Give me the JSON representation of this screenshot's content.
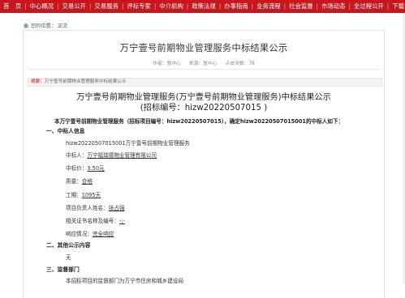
{
  "nav": {
    "items": [
      "首　页",
      "中心概况",
      "交易公开",
      "交易服务",
      "评标专家",
      "中介机构",
      "政策法规",
      "办事指南",
      "业务流程",
      "社会监督",
      "市场动态",
      "全过程公开",
      "下载专区"
    ]
  },
  "breadcrumb": {
    "prefix": "您的位置：",
    "current": "正文"
  },
  "article": {
    "title": "万宁壹号前期物业管理服务中标结果公示",
    "meta": {
      "author": "作者：暂中心",
      "source": "来源：暂中心",
      "views": "点击次数：76"
    },
    "summary_label": "摘要：",
    "summary_text": "万宁壹号前期物业管理服务中标结果公示",
    "doc_title_line1": "万宁壹号前期物业管理服务(万宁壹号前期物业管理服务)中标结果公示",
    "doc_title_line2": "(招标编号：hizw20220507015 )",
    "notice": "本万宁壹号前期物业管理服务（招标项目编号：hizw20220507015），确定hizw20220507015001的中标人如下：",
    "sections": {
      "s1": "一、中标人信息",
      "s2": "二、其他公示内容",
      "s3": "三、监督部门"
    },
    "bid": {
      "package": "hizw20220507015001万宁壹号前期物业管理服务",
      "winner_label": "中标人：",
      "winner": "万宁福瑞德物业管理有限公司",
      "price_label": "中标价：",
      "price": "3.50元",
      "quality_label": "质量：",
      "quality": "合格",
      "period_label": "工期：",
      "period": "1095天",
      "manager_label": "项目负责人姓名：",
      "manager": "张占强",
      "cert_label": "相关证书名称及编号：",
      "cert": "-;-",
      "response_label": "响应情况：",
      "response": "完全响应"
    },
    "other": "无",
    "supervision": "本招标项目的监督部门为万宁市住房和城乡建设局"
  }
}
